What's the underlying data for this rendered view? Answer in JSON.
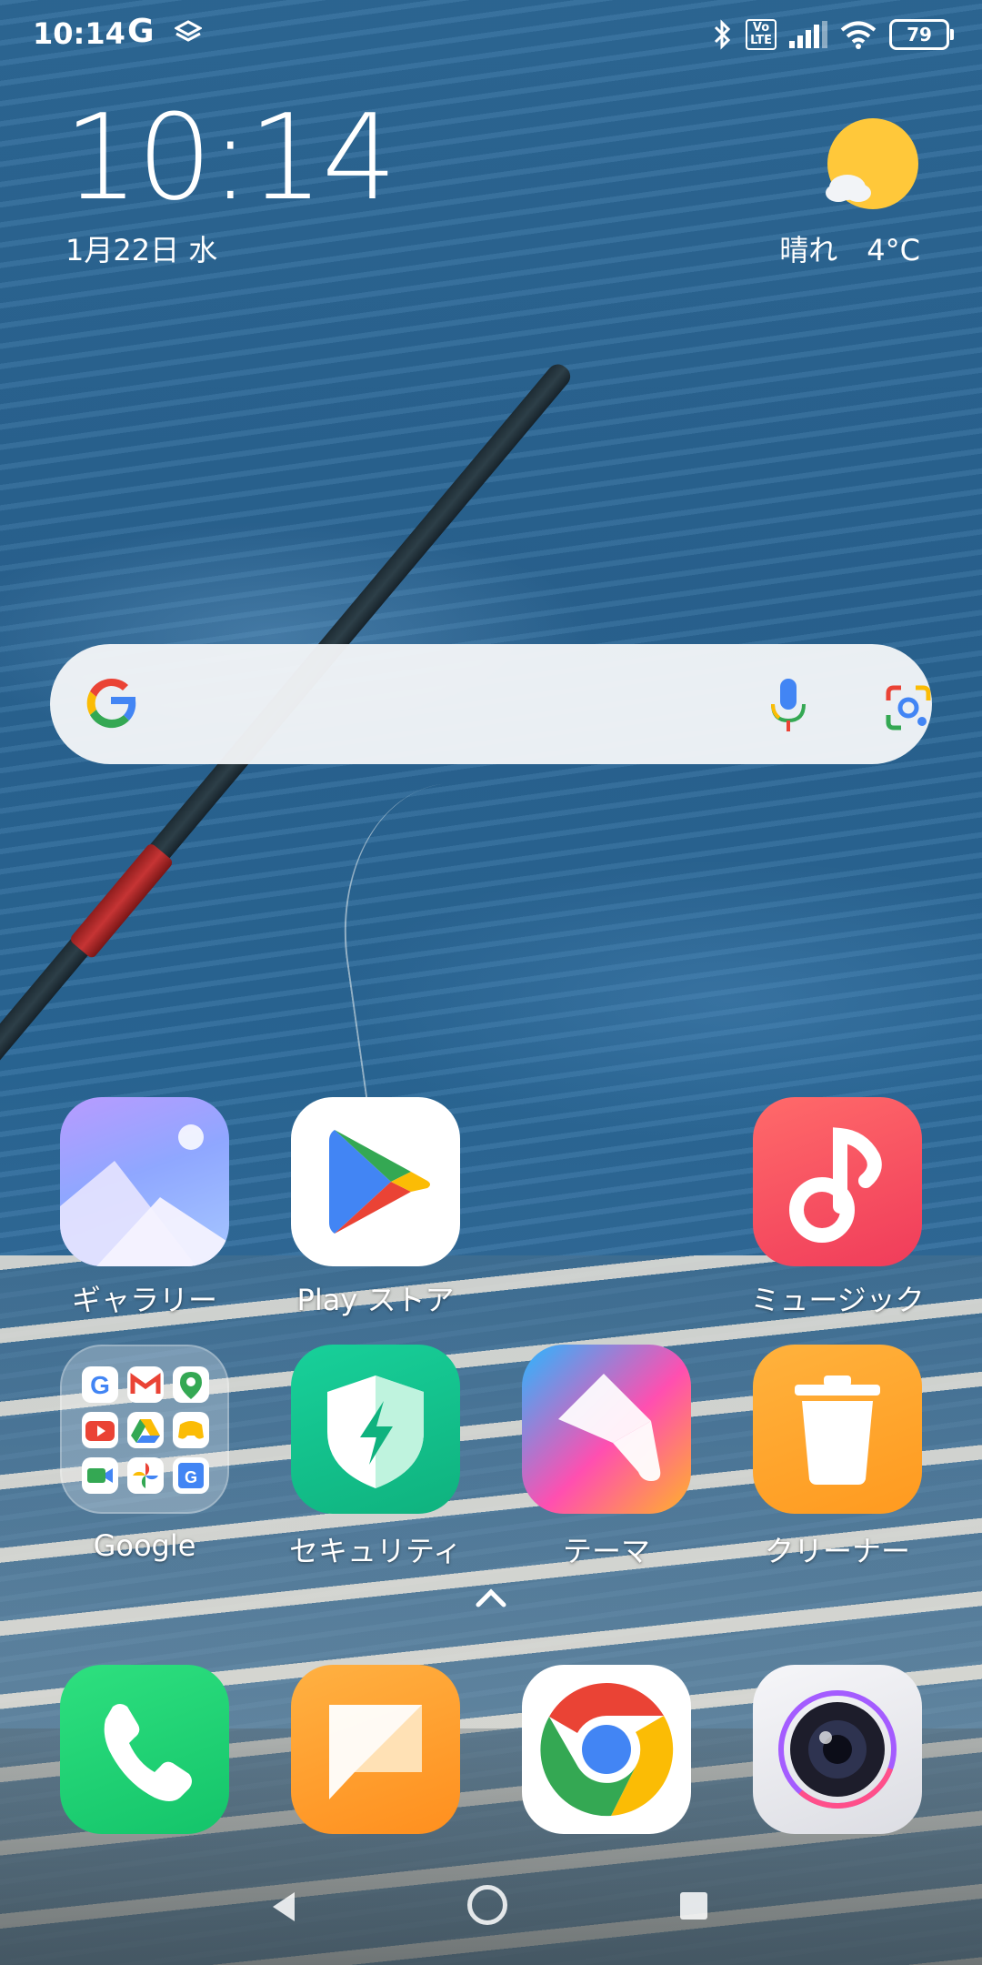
{
  "status_bar": {
    "time": "10:14",
    "g_indicator": "G",
    "battery": "79",
    "volte": "Vo\nLTE",
    "icons": [
      "google-icon",
      "stack-icon",
      "bluetooth-icon",
      "volte-icon",
      "signal-icon",
      "wifi-icon",
      "battery-icon"
    ]
  },
  "clock_widget": {
    "time": "10:14",
    "date": "1月22日 水",
    "weather": "晴れ　4°C",
    "weather_icon": "sun-cloud-icon"
  },
  "search": {
    "icons": [
      "google-logo-icon",
      "microphone-icon",
      "google-lens-icon"
    ]
  },
  "apps_row1": [
    {
      "label": "ギャラリー",
      "icon": "gallery-icon"
    },
    {
      "label": "Play ストア",
      "icon": "play-store-icon"
    },
    {
      "label": "ミュージック",
      "icon": "music-icon"
    }
  ],
  "apps_row2": [
    {
      "label": "Google",
      "icon": "google-folder-icon"
    },
    {
      "label": "セキュリティ",
      "icon": "security-icon"
    },
    {
      "label": "テーマ",
      "icon": "themes-icon"
    },
    {
      "label": "クリーナー",
      "icon": "cleaner-icon"
    }
  ],
  "dock": [
    {
      "icon": "phone-icon"
    },
    {
      "icon": "messages-icon"
    },
    {
      "icon": "chrome-icon"
    },
    {
      "icon": "camera-icon"
    }
  ],
  "colors": {
    "google_blue": "#4285F4",
    "google_red": "#EA4335",
    "google_yellow": "#FBBC05",
    "google_green": "#34A853"
  }
}
